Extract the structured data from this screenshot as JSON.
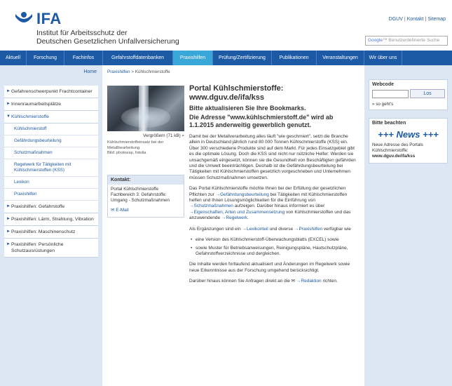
{
  "header": {
    "logo_text": "IFA",
    "institute_line1": "Institut für Arbeitsschutz der",
    "institute_line2": "Deutschen Gesetzlichen Unfallversicherung",
    "top_links": [
      "DGUV",
      "Kontakt",
      "Sitemap"
    ],
    "search_placeholder_google": "Google",
    "search_placeholder_text": "Benutzerdefinierte Suche"
  },
  "nav": {
    "items": [
      "Aktuell",
      "Forschung",
      "Fachinfos",
      "Gefahrstoffdatenbanken",
      "Praxishilfen",
      "Prüfung/Zertifizierung",
      "Publikationen",
      "Veranstaltungen",
      "Wir über uns"
    ],
    "active": "Praxishilfen"
  },
  "sidebar": {
    "home": "Home",
    "groups_before": [
      "Gefahrenschwerpunkt Frachtcontainer",
      "Innenraumarbeitsplätze"
    ],
    "open_group": "Kühlschmierstoffe",
    "subitems": [
      "Kühlschmierstoff",
      "Gefährdungsbeurteilung",
      "Schutzmaßnahmen",
      "Regelwerk für Tätigkeiten mit Kühlschmierstoffen (KSS)",
      "Lexikon",
      "Praxishilfen"
    ],
    "groups_after": [
      "Praxishilfen: Gefahrstoffe",
      "Praxishilfen: Lärm, Strahlung, Vibration",
      "Praxishilfen: Maschinenschutz",
      "Praxishilfen: Persönliche Schutzausrüstungen"
    ]
  },
  "breadcrumb": {
    "root": "Praxishilfen",
    "sep": ">",
    "current": "Kühlschmierstoffe"
  },
  "image": {
    "enlarge_label": "Vergrößern (71 kB)",
    "caption": "Kühlschmierstoffeinsatz bei der Metallbearbeitung",
    "credit": "Bild: photoesp, fotolia"
  },
  "contact": {
    "title": "Kontakt:",
    "body": "Portal Kühlschmierstoffe Fachbereich 3: Gefahrstoffe: Umgang - Schutzmaßnahmen",
    "mail": "E-Mail"
  },
  "content": {
    "title_line1": "Portal Kühlschmierstoffe:",
    "title_line2": "www.dguv.de/ifa/kss",
    "subtitle": "Bitte aktualisieren Sie Ihre Bookmarks.",
    "note": "Die Adresse \"www.kühlschmierstoff.de\" wird ab 1.1.2015 anderweitig gewerblich genutzt.",
    "p1": "Damit bei der Metallverarbeitung alles läuft \"wie geschmiert\", setzt die Branche allein in Deutschland jährlich rund 80 000 Tonnen Kühlschmierstoffe (KSS) ein. Über 300 verschiedene Produkte sind auf dem Markt. Für jedes Einsatzgebiet gibt es die optimale Lösung. Doch die KSS sind nicht nur nützliche Helfer: Werden sie unsachgemäß eingesetzt, können sie die Gesundheit von Beschäftigten gefährden und die Umwelt beeinträchtigen. Deshalb ist die Gefährdungsbeurteilung bei Tätigkeiten mit Kühlschmierstoffen gesetzlich vorgeschrieben und Unternehmen müssen Schutzmaßnahmen umsetzen.",
    "p2_a": "Das Portal Kühlschmierstoffe möchte Ihnen bei der Erfüllung der gesetzlichen Pflichten zur",
    "p2_link1": "Gefährdungsbeurteilung",
    "p2_b": "bei Tätigkeiten mit Kühlschmierstoffen helfen und Ihnen Lösungsmöglichkeiten für die Einführung von",
    "p2_link2": "Schutzmaßnahmen",
    "p2_c": "aufzeigen. Darüber hinaus informiert es über",
    "p2_link3": "Eigenschaften, Arten und Zusammensetzung",
    "p2_d": "von Kühlschmierstoffen und das anzuwendende",
    "p2_link4": "Regelwerk",
    "p3_a": "Als Ergänzungen sind ein",
    "p3_link1": "Lexikonteil",
    "p3_b": "und diverse",
    "p3_link2": "Praxishilfen",
    "p3_c": "verfügbar wie",
    "bullets": [
      "eine Version des Kühlschmierstoff-Überwachungsblatts (EXCEL) sowie",
      "sowie Muster für Betriebsanweisungen, Reinigungspläne, Hautschutzpläne, Gefahrstoffverzeichnisse und dergleichen."
    ],
    "p4": "Die Inhalte werden fortlaufend aktualisiert und Änderungen im Regelwerk sowie neue Erkenntnisse aus der Forschung umgehend berücksichtigt.",
    "p5_a": "Darüber hinaus können Sie Anfragen direkt an die",
    "p5_link": "Redaktion",
    "p5_b": "richten."
  },
  "right": {
    "webcode_title": "Webcode",
    "webcode_button": "Los",
    "webcode_help": "» so geht's",
    "notice_title": "Bitte beachten",
    "news_banner": "+++ News +++",
    "news_text": "Neue Adresse des Portals Kühlschmierstoffe:",
    "news_url": "www.dguv.de/ifa/kss"
  },
  "colors": {
    "brand_blue": "#1d5aa6",
    "nav_active": "#39a7d8",
    "side_bg": "#dde6f3"
  }
}
